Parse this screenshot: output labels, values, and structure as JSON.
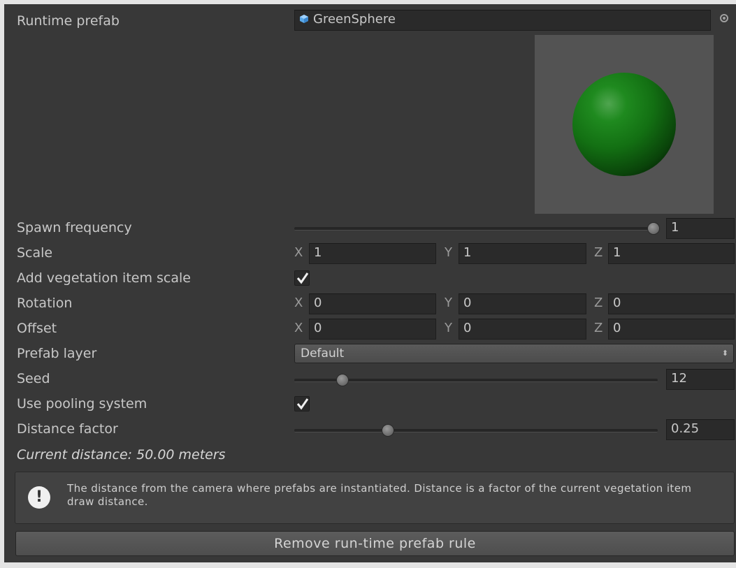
{
  "runtime_prefab": {
    "label": "Runtime prefab",
    "value": "GreenSphere",
    "icon": "prefab-cube-icon"
  },
  "spawn_frequency": {
    "label": "Spawn frequency",
    "value": "1",
    "slider_fraction": 1.0
  },
  "scale": {
    "label": "Scale",
    "x_label": "X",
    "y_label": "Y",
    "z_label": "Z",
    "x": "1",
    "y": "1",
    "z": "1"
  },
  "add_vegetation_item_scale": {
    "label": "Add vegetation item scale",
    "checked": true
  },
  "rotation": {
    "label": "Rotation",
    "x_label": "X",
    "y_label": "Y",
    "z_label": "Z",
    "x": "0",
    "y": "0",
    "z": "0"
  },
  "offset": {
    "label": "Offset",
    "x_label": "X",
    "y_label": "Y",
    "z_label": "Z",
    "x": "0",
    "y": "0",
    "z": "0"
  },
  "prefab_layer": {
    "label": "Prefab layer",
    "value": "Default",
    "arrows": "⬍"
  },
  "seed": {
    "label": "Seed",
    "value": "12",
    "slider_fraction": 0.13
  },
  "use_pooling_system": {
    "label": "Use pooling system",
    "checked": true
  },
  "distance_factor": {
    "label": "Distance factor",
    "value": "0.25",
    "slider_fraction": 0.25
  },
  "current_distance": "Current distance: 50.00 meters",
  "help": {
    "icon": "exclamation-icon",
    "text": "The distance from the camera where prefabs are instantiated. Distance is a factor of the current vegetation item draw distance."
  },
  "remove_button": "Remove run-time prefab rule",
  "colors": {
    "panel_bg": "#383838",
    "field_bg": "#2a2a2a",
    "sphere": "#137013"
  }
}
